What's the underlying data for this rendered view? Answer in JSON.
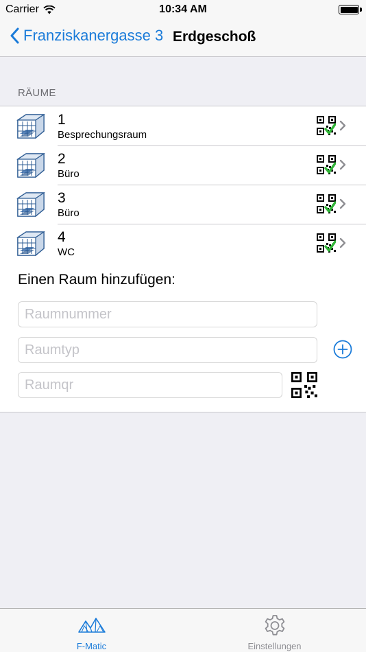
{
  "status_bar": {
    "carrier": "Carrier",
    "time": "10:34 AM",
    "battery_level": 1.0
  },
  "nav": {
    "back_label": "Franziskanergasse 3",
    "title": "Erdgeschoß"
  },
  "rooms_section": {
    "header": "RÄUME",
    "rooms": [
      {
        "number": "1",
        "type": "Besprechungsraum"
      },
      {
        "number": "2",
        "type": "Büro"
      },
      {
        "number": "3",
        "type": "Büro"
      },
      {
        "number": "4",
        "type": "WC"
      }
    ]
  },
  "add_room": {
    "title": "Einen Raum hinzufügen:",
    "number_placeholder": "Raumnummer",
    "type_placeholder": "Raumtyp",
    "qr_placeholder": "Raumqr",
    "number_value": "",
    "type_value": "",
    "qr_value": ""
  },
  "tabs": [
    {
      "label": "F-Matic",
      "icon": "mountains-icon",
      "selected": true
    },
    {
      "label": "Einstellungen",
      "icon": "gear-icon",
      "selected": false
    }
  ],
  "colors": {
    "accent": "#1a7bd9",
    "background": "#efeff4",
    "check_green": "#2fb536"
  }
}
